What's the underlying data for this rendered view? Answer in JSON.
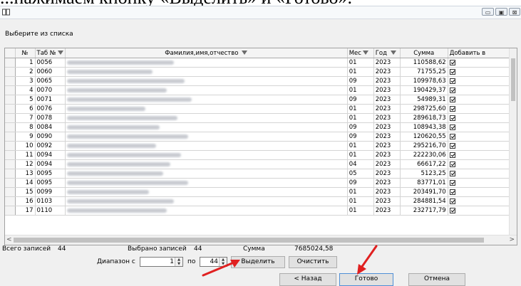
{
  "caption": "...нажимаем кнопку «Выделить» и «Готово».",
  "window": {
    "app_icon": "book-icon",
    "buttons": [
      "minimize-icon",
      "maximize-icon",
      "close-icon"
    ]
  },
  "prompt": "Выберите из списка",
  "columns": [
    "№",
    "Таб №",
    "Фамилия,имя,отчество",
    "Мес",
    "Год",
    "Сумма",
    "Добавить в"
  ],
  "rows": [
    {
      "n": "1",
      "tab": "0056",
      "name": "",
      "mes": "01",
      "god": "2023",
      "sum": "110588,62"
    },
    {
      "n": "2",
      "tab": "0060",
      "name": "",
      "mes": "01",
      "god": "2023",
      "sum": "71755,25"
    },
    {
      "n": "3",
      "tab": "0065",
      "name": "",
      "mes": "09",
      "god": "2023",
      "sum": "109978,63"
    },
    {
      "n": "4",
      "tab": "0070",
      "name": "",
      "mes": "01",
      "god": "2023",
      "sum": "190429,37"
    },
    {
      "n": "5",
      "tab": "0071",
      "name": "",
      "mes": "09",
      "god": "2023",
      "sum": "54989,31"
    },
    {
      "n": "6",
      "tab": "0076",
      "name": "",
      "mes": "01",
      "god": "2023",
      "sum": "298725,60"
    },
    {
      "n": "7",
      "tab": "0078",
      "name": "",
      "mes": "01",
      "god": "2023",
      "sum": "289618,73"
    },
    {
      "n": "8",
      "tab": "0084",
      "name": "",
      "mes": "09",
      "god": "2023",
      "sum": "108943,38"
    },
    {
      "n": "9",
      "tab": "0090",
      "name": "",
      "mes": "09",
      "god": "2023",
      "sum": "120620,55"
    },
    {
      "n": "10",
      "tab": "0092",
      "name": "",
      "mes": "01",
      "god": "2023",
      "sum": "295216,70"
    },
    {
      "n": "11",
      "tab": "0094",
      "name": "",
      "mes": "01",
      "god": "2023",
      "sum": "222230,06"
    },
    {
      "n": "12",
      "tab": "0094",
      "name": "",
      "mes": "04",
      "god": "2023",
      "sum": "66617,22"
    },
    {
      "n": "13",
      "tab": "0095",
      "name": "",
      "mes": "05",
      "god": "2023",
      "sum": "5123,25"
    },
    {
      "n": "14",
      "tab": "0095",
      "name": "",
      "mes": "09",
      "god": "2023",
      "sum": "83771,01"
    },
    {
      "n": "15",
      "tab": "0099",
      "name": "",
      "mes": "01",
      "god": "2023",
      "sum": "203491,70"
    },
    {
      "n": "16",
      "tab": "0103",
      "name": "",
      "mes": "01",
      "god": "2023",
      "sum": "284881,54"
    },
    {
      "n": "17",
      "tab": "0110",
      "name": "",
      "mes": "01",
      "god": "2023",
      "sum": "232717,79"
    }
  ],
  "summary": {
    "total_label": "Всего записей",
    "total_value": "44",
    "selected_label": "Выбрано записей",
    "selected_value": "44",
    "sum_label": "Сумма",
    "sum_value": "7685024,58"
  },
  "range": {
    "label_from": "Диапазон с",
    "from_value": "1",
    "label_to": "по",
    "to_value": "44",
    "select_button": "Выделить",
    "clear_button": "Очистить"
  },
  "footer": {
    "back_button": "< Назад",
    "done_button": "Готово",
    "cancel_button": "Отмена"
  },
  "colors": {
    "annotation_arrow": "#e02020",
    "window_bg": "#f0f0f0"
  }
}
